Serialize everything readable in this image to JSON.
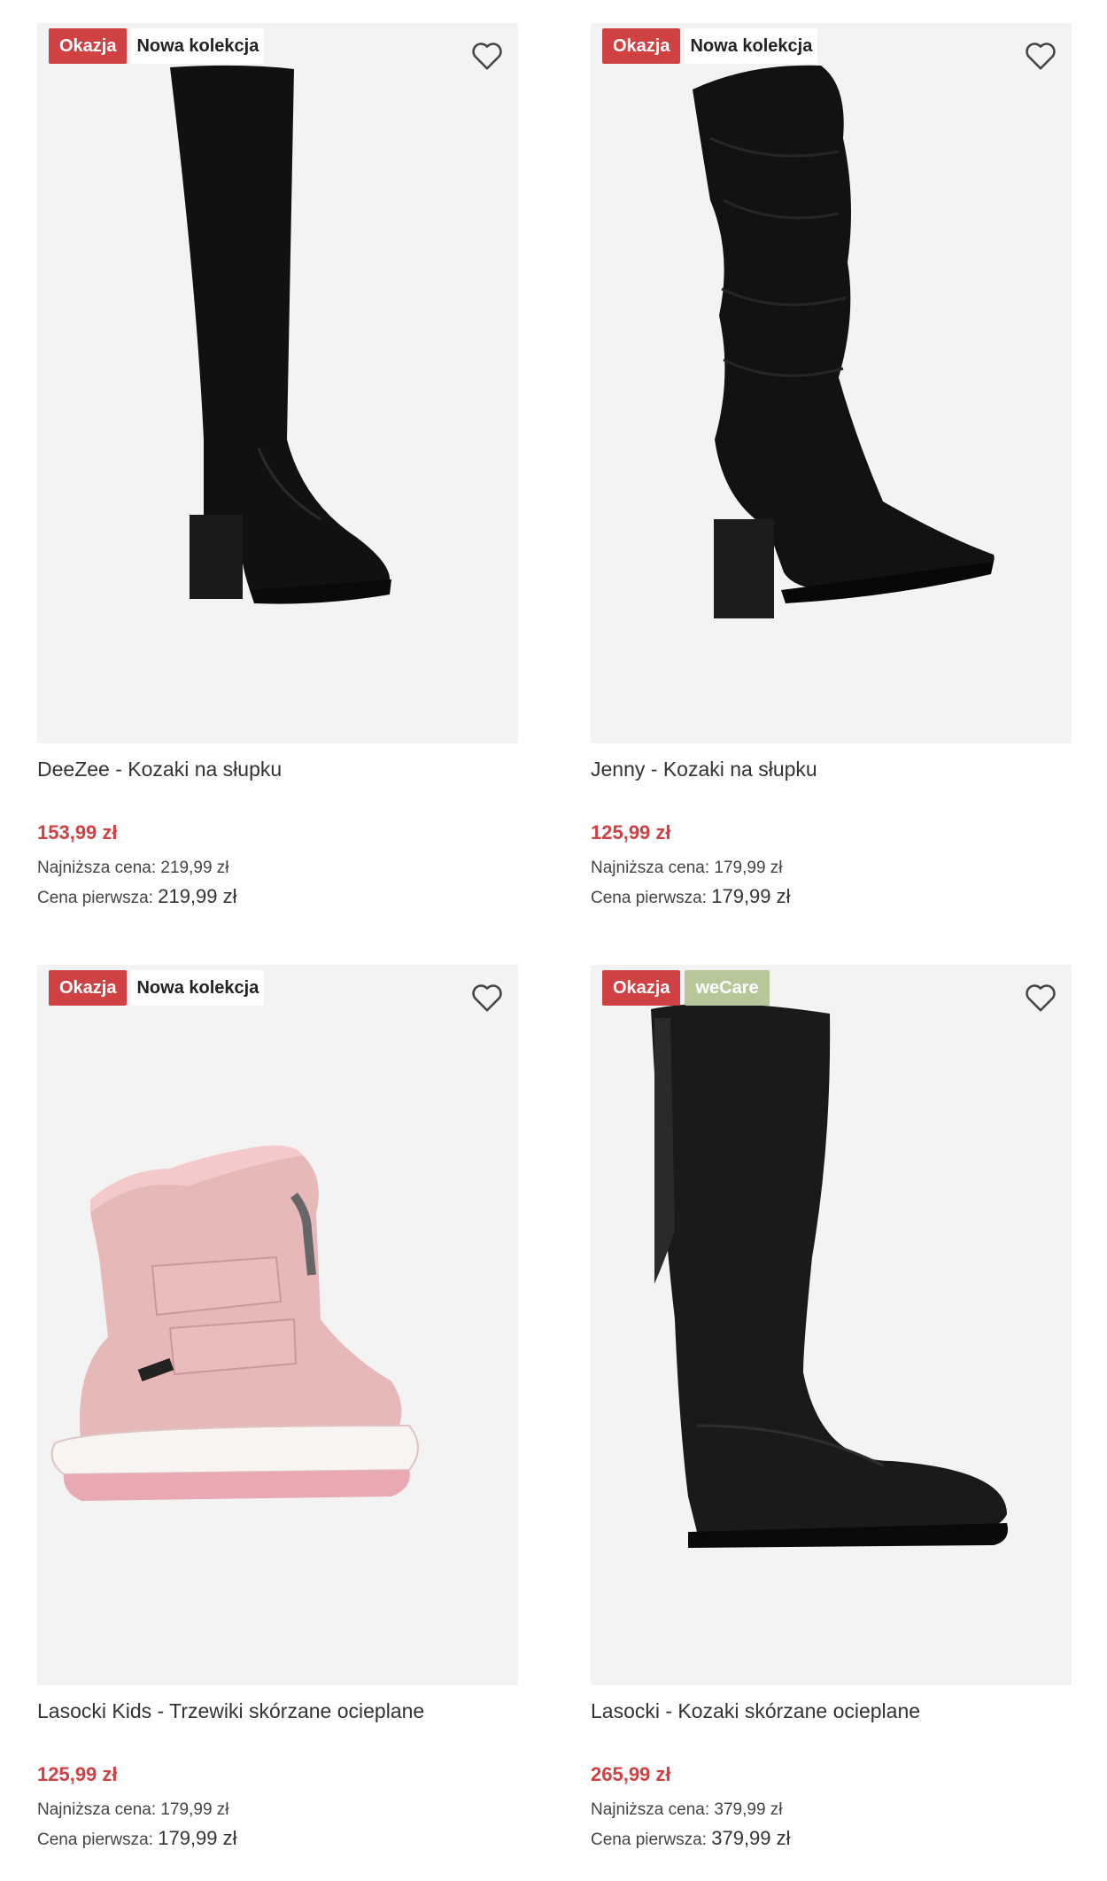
{
  "products": [
    {
      "badges": [
        "Okazja",
        "Nowa kolekcja"
      ],
      "title": "DeeZee - Kozaki na słupku",
      "price": "153,99 zł",
      "lowest_label": "Najniższa cena:",
      "lowest_value": "219,99 zł",
      "first_label": "Cena pierwsza:",
      "first_value": "219,99 zł"
    },
    {
      "badges": [
        "Okazja",
        "Nowa kolekcja"
      ],
      "title": "Jenny - Kozaki na słupku",
      "price": "125,99 zł",
      "lowest_label": "Najniższa cena:",
      "lowest_value": "179,99 zł",
      "first_label": "Cena pierwsza:",
      "first_value": "179,99 zł"
    },
    {
      "badges": [
        "Okazja",
        "Nowa kolekcja"
      ],
      "title": "Lasocki Kids - Trzewiki skórzane ocieplane",
      "price": "125,99 zł",
      "lowest_label": "Najniższa cena:",
      "lowest_value": "179,99 zł",
      "first_label": "Cena pierwsza:",
      "first_value": "179,99 zł"
    },
    {
      "badges": [
        "Okazja",
        "weCare"
      ],
      "title": "Lasocki - Kozaki skórzane ocieplane",
      "price": "265,99 zł",
      "lowest_label": "Najniższa cena:",
      "lowest_value": "379,99 zł",
      "first_label": "Cena pierwsza:",
      "first_value": "379,99 zł"
    }
  ],
  "icons": {
    "favorite": "heart-outline-icon"
  },
  "colors": {
    "sale": "#d04144",
    "wecare": "#b7c79a",
    "image_bg": "#f3f3f3"
  }
}
